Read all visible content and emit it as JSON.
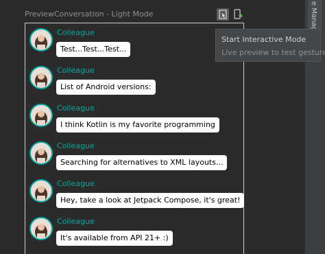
{
  "preview": {
    "title": "PreviewConversation - Light Mode",
    "messages": [
      {
        "author": "Colleague",
        "body": "Test...Test...Test..."
      },
      {
        "author": "Colleague",
        "body": "List of Android versions:"
      },
      {
        "author": "Colleague",
        "body": "I think Kotlin is my favorite programming"
      },
      {
        "author": "Colleague",
        "body": "Searching for alternatives to XML layouts..."
      },
      {
        "author": "Colleague",
        "body": "Hey, take a look at Jetpack Compose, it's great!"
      },
      {
        "author": "Colleague",
        "body": "It's available from API 21+ :)"
      }
    ]
  },
  "toolbar": {
    "interactive_icon": "interactive-mode-icon",
    "deploy_icon": "deploy-to-device-icon"
  },
  "tooltip": {
    "title": "Start Interactive Mode",
    "description": "Live preview to test gestures"
  },
  "side_panel": {
    "tab_label": "e Manag"
  },
  "colors": {
    "accent": "#03a9a1",
    "background": "#2b2b2b",
    "bubble": "#ffffff"
  }
}
